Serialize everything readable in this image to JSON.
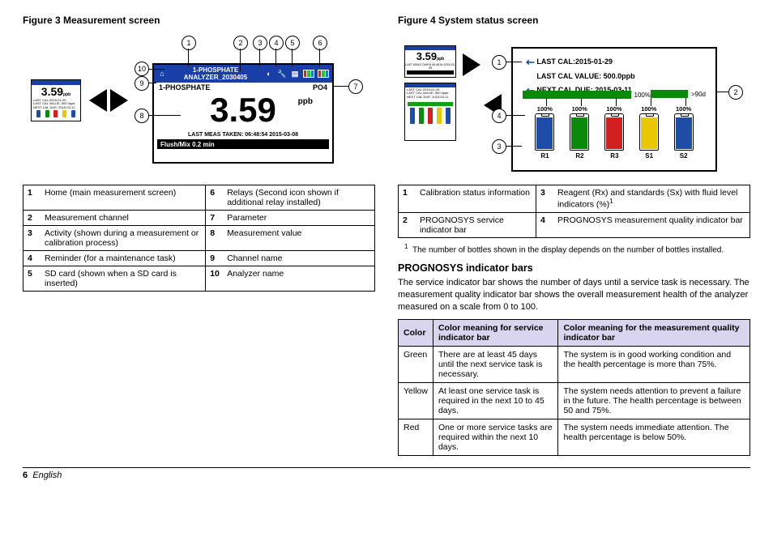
{
  "figure3": {
    "title": "Figure 3  Measurement screen",
    "thumb_value": "3.59",
    "screen": {
      "analyzer_name": "ANALYZER_2030405",
      "channel_title": "1-PHOSPHATE",
      "channel_name": "1-PHOSPHATE",
      "parameter": "PO4",
      "value": "3.59",
      "unit": "ppb",
      "last_meas": "LAST MEAS TAKEN: 06:48:54  2015-03-08",
      "flush": "Flush/Mix  0.2 min"
    },
    "callouts": [
      "1",
      "2",
      "3",
      "4",
      "5",
      "6",
      "7",
      "8",
      "9",
      "10"
    ],
    "key": [
      {
        "n": "1",
        "t": "Home (main measurement screen)",
        "n2": "6",
        "t2": "Relays (Second icon shown if additional relay installed)"
      },
      {
        "n": "2",
        "t": "Measurement channel",
        "n2": "7",
        "t2": "Parameter"
      },
      {
        "n": "3",
        "t": "Activity (shown during a measurement or calibration process)",
        "n2": "8",
        "t2": "Measurement value"
      },
      {
        "n": "4",
        "t": "Reminder (for a maintenance task)",
        "n2": "9",
        "t2": "Channel name"
      },
      {
        "n": "5",
        "t": "SD card (shown when a SD card is inserted)",
        "n2": "10",
        "t2": "Analyzer name"
      }
    ]
  },
  "figure4": {
    "title": "Figure 4  System status screen",
    "thumb_value": "3.59",
    "callouts": [
      "1",
      "2",
      "3",
      "4"
    ],
    "cal": {
      "line1": "LAST CAL:2015-01-29",
      "line2": "LAST CAL VALUE: 500.0ppb",
      "line3": "NEXT CAL DUE: 2015-03-11"
    },
    "prog_pct": "100%",
    "days": ">90d",
    "pcts": [
      "100%",
      "100%",
      "100%",
      "100%",
      "100%"
    ],
    "labels": [
      "R1",
      "R2",
      "R3",
      "S1",
      "S2"
    ],
    "bottle_colors": [
      "#1d4da5",
      "#0a8a0a",
      "#d22020",
      "#e8c800",
      "#1d4da5"
    ],
    "key": [
      {
        "n": "1",
        "t": "Calibration status information",
        "n2": "3",
        "t2": "Reagent (Rx) and standards (Sx) with fluid level indicators (%)",
        "sup": "1"
      },
      {
        "n": "2",
        "t": "PROGNOSYS service indicator bar",
        "n2": "4",
        "t2": "PROGNOSYS measurement quality indicator bar"
      }
    ],
    "footnote": "The number of bottles shown in the display depends on the number of bottles installed.",
    "section_title": "PROGNOSYS indicator bars",
    "section_body": "The service indicator bar shows the number of days until a service task is necessary. The measurement quality indicator bar shows the overall measurement health of the analyzer measured on a scale from 0 to 100.",
    "color_table": {
      "head": [
        "Color",
        "Color meaning for service indicator bar",
        "Color meaning for the measurement quality indicator bar"
      ],
      "rows": [
        {
          "c": "Green",
          "s": "There are at least 45 days until the next service task is necessary.",
          "m": "The system is in good working condition and the health percentage is more than 75%."
        },
        {
          "c": "Yellow",
          "s": "At least one service task is required in the next 10 to 45 days.",
          "m": "The system needs attention to prevent a failure in the future. The health percentage is between 50 and 75%."
        },
        {
          "c": "Red",
          "s": "One or more service tasks are required within the next 10 days.",
          "m": "The system needs immediate attention. The health percentage is below 50%."
        }
      ]
    }
  },
  "footer": {
    "page": "6",
    "lang": "English"
  }
}
